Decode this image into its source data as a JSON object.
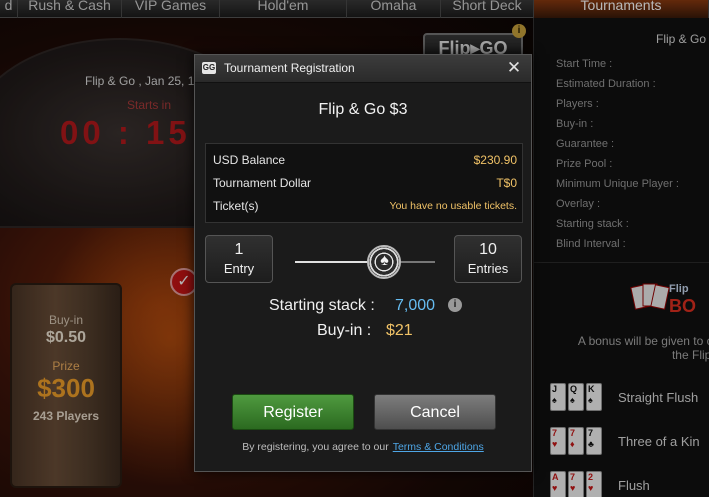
{
  "nav": {
    "tabs": [
      {
        "label": "d",
        "width": 18
      },
      {
        "label": "Rush & Cash",
        "width": 104
      },
      {
        "label": "VIP Games",
        "width": 98
      },
      {
        "label": "Hold'em",
        "width": 127
      },
      {
        "label": "Omaha",
        "width": 94
      },
      {
        "label": "Short Deck",
        "width": 93
      },
      {
        "label": "Tournaments",
        "width": 175
      }
    ],
    "active_index": 6
  },
  "background": {
    "event_title": "Flip & Go , Jan 25, 1",
    "starts_in_label": "Starts in",
    "countdown": "00 : 15 :",
    "logo_text": "Flip▸GO",
    "logo_info": "i",
    "sign": {
      "buyin_label": "Buy-in",
      "buyin_value": "$0.50",
      "prize_label": "Prize",
      "prize_value": "$300",
      "players": "243 Players"
    }
  },
  "right_panel": {
    "title": "Flip & Go",
    "fields": [
      "Start Time :",
      "Estimated Duration :",
      "Players :",
      "Buy-in :",
      "Guarantee :",
      "Prize Pool :",
      "Minimum Unique Player :",
      "Overlay :",
      "Starting stack :",
      "Blind Interval :"
    ],
    "promo_text": "Flip BO",
    "bonus_line1": "A bonus will be given to con",
    "bonus_line2": "the Flip St",
    "hands": [
      {
        "label": "Straight Flush",
        "cards": [
          {
            "r": "J",
            "s": "♠",
            "c": "blk"
          },
          {
            "r": "Q",
            "s": "♠",
            "c": "blk"
          },
          {
            "r": "K",
            "s": "♠",
            "c": "blk"
          }
        ]
      },
      {
        "label": "Three of a Kin",
        "cards": [
          {
            "r": "7",
            "s": "♥",
            "c": "red"
          },
          {
            "r": "7",
            "s": "♦",
            "c": "red"
          },
          {
            "r": "7",
            "s": "♣",
            "c": "blk"
          }
        ]
      },
      {
        "label": "Flush",
        "cards": [
          {
            "r": "A",
            "s": "♥",
            "c": "red"
          },
          {
            "r": "7",
            "s": "♥",
            "c": "red"
          },
          {
            "r": "2",
            "s": "♥",
            "c": "red"
          }
        ]
      }
    ]
  },
  "dialog": {
    "logo": "GG",
    "title": "Tournament Registration",
    "close_icon": "✕",
    "tournament_name": "Flip & Go $3",
    "balances": [
      {
        "label": "USD Balance",
        "value": "$230.90"
      },
      {
        "label": "Tournament Dollar",
        "value": "T$0"
      },
      {
        "label": "Ticket(s)",
        "value": "You have no usable tickets."
      }
    ],
    "min_entries": {
      "number": "1",
      "label": "Entry"
    },
    "max_entries": {
      "number": "10",
      "label": "Entries"
    },
    "slider_fraction": 0.65,
    "starting_stack_label": "Starting stack :",
    "starting_stack_value": "7,000",
    "info_icon": "i",
    "buyin_label": "Buy-in :",
    "buyin_value": "$21",
    "register_label": "Register",
    "cancel_label": "Cancel",
    "terms_prefix": "By registering, you agree to our",
    "terms_link": "Terms & Conditions"
  },
  "colors": {
    "accent_gold": "#f0c267",
    "accent_blue": "#66bdf2",
    "register_green": "#3f8a31",
    "countdown_red": "#b3191c"
  }
}
